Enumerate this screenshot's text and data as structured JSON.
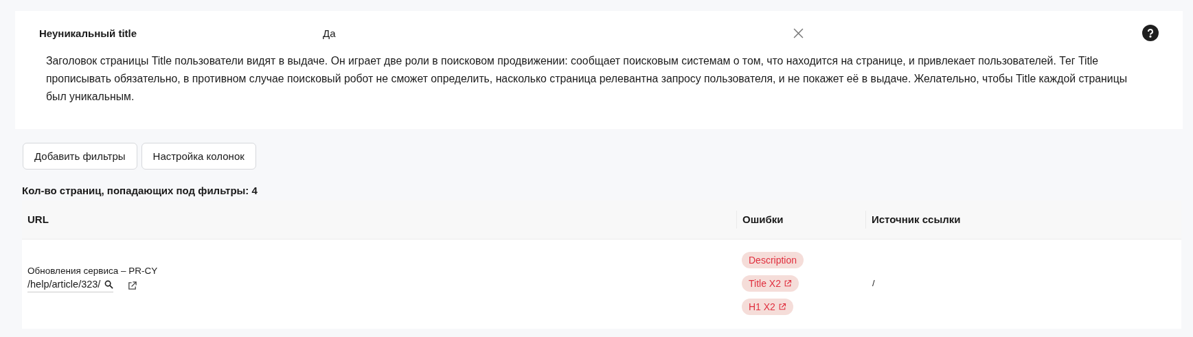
{
  "issue": {
    "title": "Неуникальный title",
    "value": "Да",
    "description": "Заголовок страницы Title пользователи видят в выдаче. Он играет две роли в поисковом продвижении: сообщает поисковым системам о том, что находится на странице, и привлекает пользователей. Тег Title прописывать обязательно, в противном случае поисковый робот не сможет определить, насколько страница релевантна запросу пользователя, и не покажет её в выдаче. Желательно, чтобы Title каждой страницы был уникальным."
  },
  "buttons": [
    "Добавить фильтры",
    "Настройка колонок"
  ],
  "count_label": "Кол-во страниц, попадающих под фильтры: 4",
  "table": {
    "columns": [
      "URL",
      "Ошибки",
      "Источник ссылки"
    ],
    "rows": [
      {
        "page_title": "Обновления сервиса – PR-CY",
        "url": "/help/article/323/",
        "errors": [
          {
            "label": "Description",
            "has_link": false
          },
          {
            "label": "Title X2",
            "has_link": true
          },
          {
            "label": "H1 X2",
            "has_link": true
          }
        ],
        "source": "/"
      }
    ]
  }
}
